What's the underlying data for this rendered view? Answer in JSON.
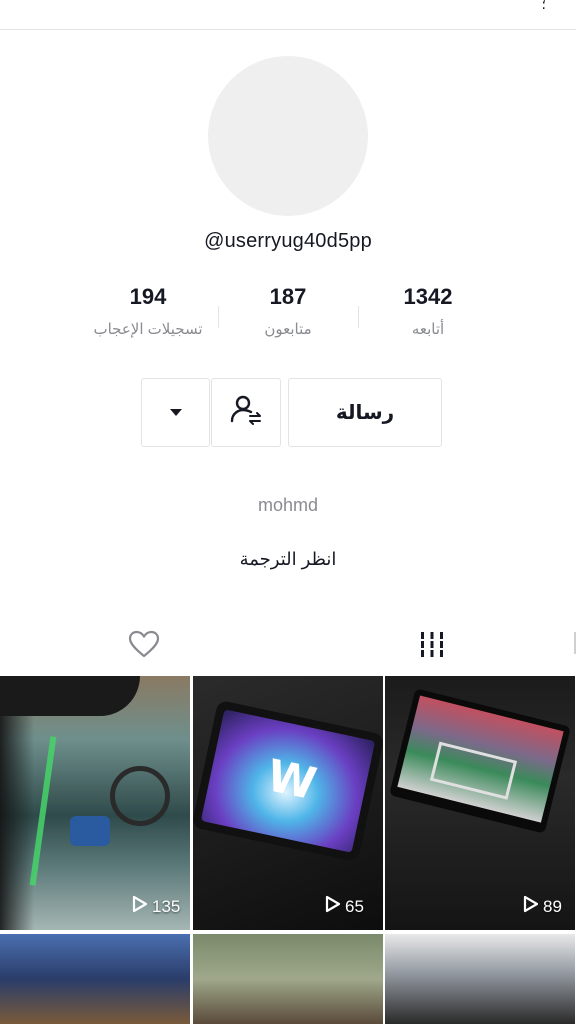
{
  "header": {
    "more_glyph": "؛"
  },
  "profile": {
    "username": "@userryug40d5pp",
    "nickname": "mohmd",
    "translate_label": "انظر الترجمة"
  },
  "stats": [
    {
      "value": "1342",
      "label": "أتابعه"
    },
    {
      "value": "187",
      "label": "متابعون"
    },
    {
      "value": "194",
      "label": "تسجيلات الإعجاب"
    }
  ],
  "actions": {
    "message_label": "رسالة",
    "follow_icon": "person-swap-icon",
    "dropdown_icon": "caret-down-icon"
  },
  "tabs": {
    "videos_icon": "grid-icon",
    "liked_icon": "heart-icon"
  },
  "videos": [
    {
      "views": "89"
    },
    {
      "views": "65"
    },
    {
      "views": "135"
    },
    {
      "views": ""
    },
    {
      "views": ""
    },
    {
      "views": ""
    }
  ],
  "colors": {
    "text": "#161823",
    "secondary_text": "#8a8b91",
    "border": "#e3e3e4",
    "avatar_bg": "#efefef"
  }
}
